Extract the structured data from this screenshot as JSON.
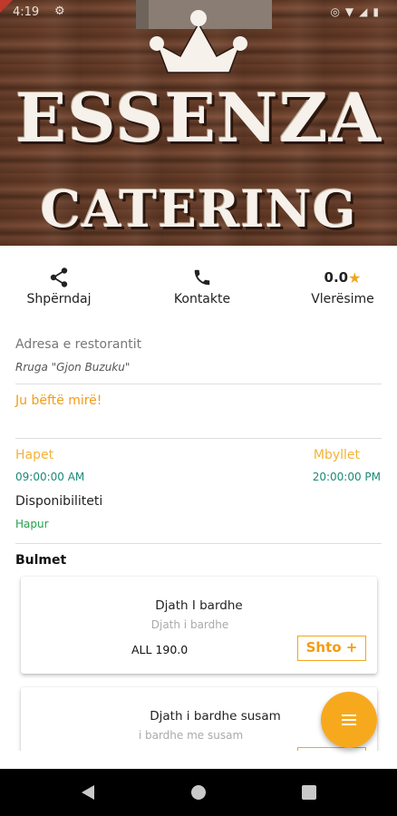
{
  "status_bar": {
    "time": "4:19",
    "icons": [
      "gear-icon",
      "location-icon",
      "wifi-icon",
      "signal-icon",
      "battery-icon"
    ]
  },
  "header": {
    "logo_line1": "ESSENZA",
    "logo_line2": "CATERING"
  },
  "actions": {
    "share_label": "Shpërndaj",
    "contact_label": "Kontakte",
    "rating_value": "0.0",
    "rating_label": "Vlerësime"
  },
  "address": {
    "label": "Adresa e restorantit",
    "value": "Rruga \"Gjon Buzuku\""
  },
  "greeting": "Ju bëftë mirë!",
  "hours": {
    "open_label": "Hapet",
    "open_time": "09:00:00 AM",
    "close_label": "Mbyllet",
    "close_time": "20:00:00 PM"
  },
  "availability": {
    "label": "Disponibiliteti",
    "value": "Hapur"
  },
  "menu_section": "Bulmet",
  "products": [
    {
      "name": "Djath I bardhe",
      "description": "Djath i bardhe",
      "price": "ALL 190.0",
      "add_label": "Shto +"
    },
    {
      "name": "Djath i bardhe susam",
      "description": "i bardhe me susam",
      "price": "",
      "add_label": ""
    }
  ],
  "colors": {
    "accent": "#f7a91e",
    "time_green": "#1a8a76",
    "open_green": "#22a24a"
  }
}
